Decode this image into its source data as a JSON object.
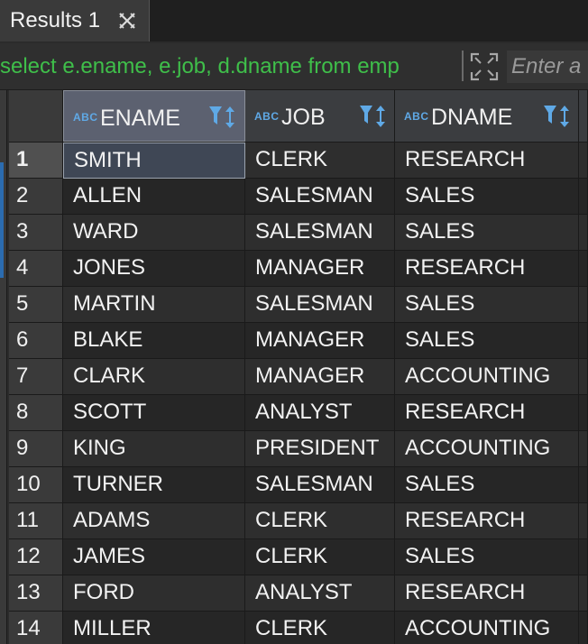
{
  "tab": {
    "label": "Results 1",
    "close_icon": "close-icon"
  },
  "query": {
    "text": "select e.ename, e.job, d.dname from emp",
    "filter_placeholder": "Enter a"
  },
  "grid": {
    "columns": [
      {
        "type_badge": "ABC",
        "label": "ENAME"
      },
      {
        "type_badge": "ABC",
        "label": "JOB"
      },
      {
        "type_badge": "ABC",
        "label": "DNAME"
      }
    ],
    "rows": [
      {
        "num": "1",
        "cells": [
          "SMITH",
          "CLERK",
          "RESEARCH"
        ]
      },
      {
        "num": "2",
        "cells": [
          "ALLEN",
          "SALESMAN",
          "SALES"
        ]
      },
      {
        "num": "3",
        "cells": [
          "WARD",
          "SALESMAN",
          "SALES"
        ]
      },
      {
        "num": "4",
        "cells": [
          "JONES",
          "MANAGER",
          "RESEARCH"
        ]
      },
      {
        "num": "5",
        "cells": [
          "MARTIN",
          "SALESMAN",
          "SALES"
        ]
      },
      {
        "num": "6",
        "cells": [
          "BLAKE",
          "MANAGER",
          "SALES"
        ]
      },
      {
        "num": "7",
        "cells": [
          "CLARK",
          "MANAGER",
          "ACCOUNTING"
        ]
      },
      {
        "num": "8",
        "cells": [
          "SCOTT",
          "ANALYST",
          "RESEARCH"
        ]
      },
      {
        "num": "9",
        "cells": [
          "KING",
          "PRESIDENT",
          "ACCOUNTING"
        ]
      },
      {
        "num": "10",
        "cells": [
          "TURNER",
          "SALESMAN",
          "SALES"
        ]
      },
      {
        "num": "11",
        "cells": [
          "ADAMS",
          "CLERK",
          "RESEARCH"
        ]
      },
      {
        "num": "12",
        "cells": [
          "JAMES",
          "CLERK",
          "SALES"
        ]
      },
      {
        "num": "13",
        "cells": [
          "FORD",
          "ANALYST",
          "RESEARCH"
        ]
      },
      {
        "num": "14",
        "cells": [
          "MILLER",
          "CLERK",
          "ACCOUNTING"
        ]
      }
    ]
  },
  "colors": {
    "query_text": "#3fbf4a",
    "type_badge": "#5fa9e6",
    "sort_icon": "#5fa9e6"
  }
}
